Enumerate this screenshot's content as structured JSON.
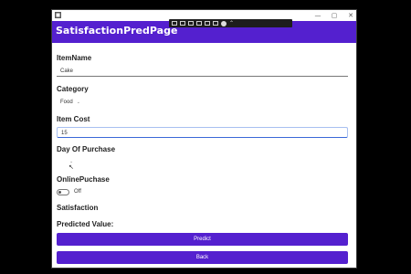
{
  "window": {
    "controls": [
      "—",
      "▢",
      "✕"
    ]
  },
  "header": {
    "title": "SatisfactionPredPage"
  },
  "form": {
    "item_name": {
      "label": "ItemName",
      "value": "Cake"
    },
    "category": {
      "label": "Category",
      "selected": "Food",
      "chevron": "⌄"
    },
    "item_cost": {
      "label": "Item Cost",
      "value": "15"
    },
    "day_of_purchase": {
      "label": "Day Of Purchase",
      "placeholder": "⌄"
    },
    "online_purchase": {
      "label": "OnlinePuchase",
      "state": "Off"
    },
    "satisfaction": {
      "label": "Satisfaction"
    },
    "predicted": {
      "label": "Predicted Value:"
    }
  },
  "buttons": {
    "predict": "Predict",
    "back": "Back"
  },
  "colors": {
    "accent": "#5420cf"
  }
}
